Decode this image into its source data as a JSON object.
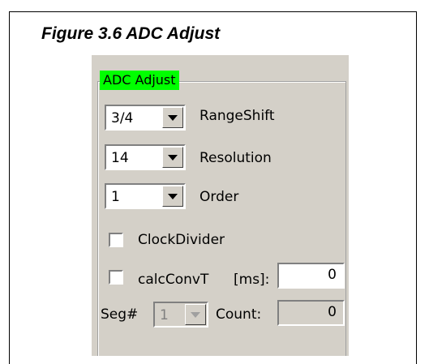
{
  "figure": {
    "caption": "Figure 3.6 ADC Adjust"
  },
  "group": {
    "title": "ADC Adjust"
  },
  "range_shift": {
    "value": "3/4",
    "label": "RangeShift"
  },
  "resolution": {
    "value": "14",
    "label": "Resolution"
  },
  "order": {
    "value": "1",
    "label": "Order"
  },
  "clock_divider": {
    "label": "ClockDivider",
    "checked": false
  },
  "calc_conv": {
    "label": "calcConvT",
    "unit_label": "[ms]:",
    "value": "0",
    "checked": false
  },
  "segment": {
    "label": "Seg#",
    "value": "1",
    "enabled": false
  },
  "count": {
    "label": "Count:",
    "value": "0"
  },
  "colors": {
    "panel": "#d4d0c8",
    "group_title_highlight": "#00ff00"
  },
  "icons": {
    "dropdown": "chevron-down-icon",
    "checkbox": "checkbox-unchecked-icon"
  }
}
